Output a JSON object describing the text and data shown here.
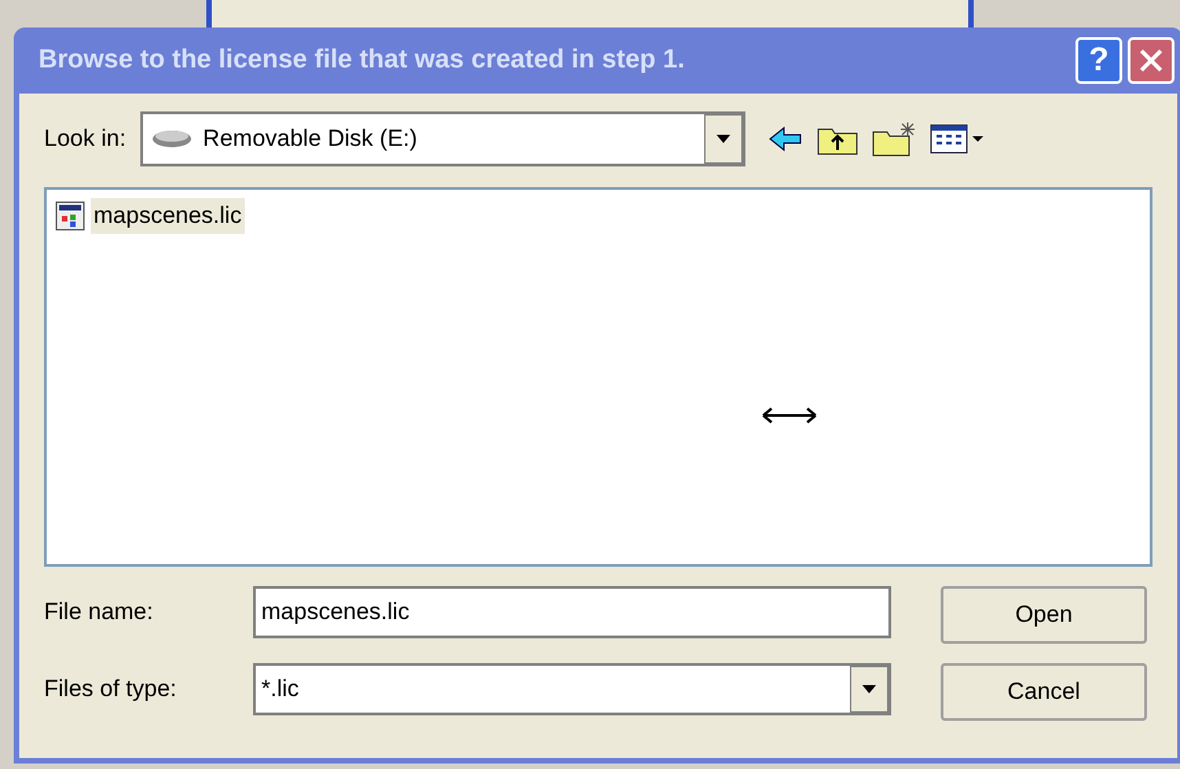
{
  "window": {
    "title": "Browse to the license file that was created in step 1.",
    "help": "?"
  },
  "look_in": {
    "label": "Look in:",
    "value": "Removable Disk (E:)"
  },
  "files": [
    {
      "name": "mapscenes.lic",
      "selected": true
    }
  ],
  "file_name": {
    "label": "File name:",
    "value": "mapscenes.lic"
  },
  "file_type": {
    "label": "Files of type:",
    "value": "*.lic"
  },
  "buttons": [
    {
      "label": "Open"
    },
    {
      "label": "Cancel"
    }
  ]
}
